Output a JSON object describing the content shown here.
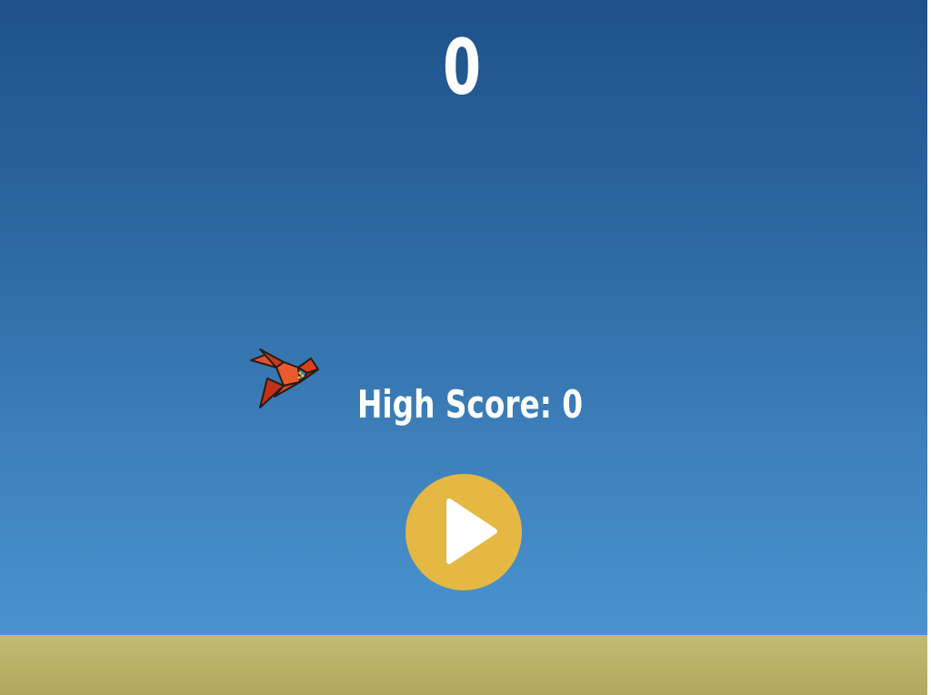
{
  "game": {
    "score": "0",
    "high_score_label": "High Score: 0"
  },
  "play_button": {
    "icon": "play-icon"
  },
  "bird": {
    "icon": "origami-bird-icon"
  },
  "colors": {
    "sky_top": "#1f518a",
    "sky_bottom": "#4a93cf",
    "ground": "#bcb46a",
    "play_button": "#e4b843",
    "bird": "#d8401e",
    "text": "#ffffff"
  }
}
